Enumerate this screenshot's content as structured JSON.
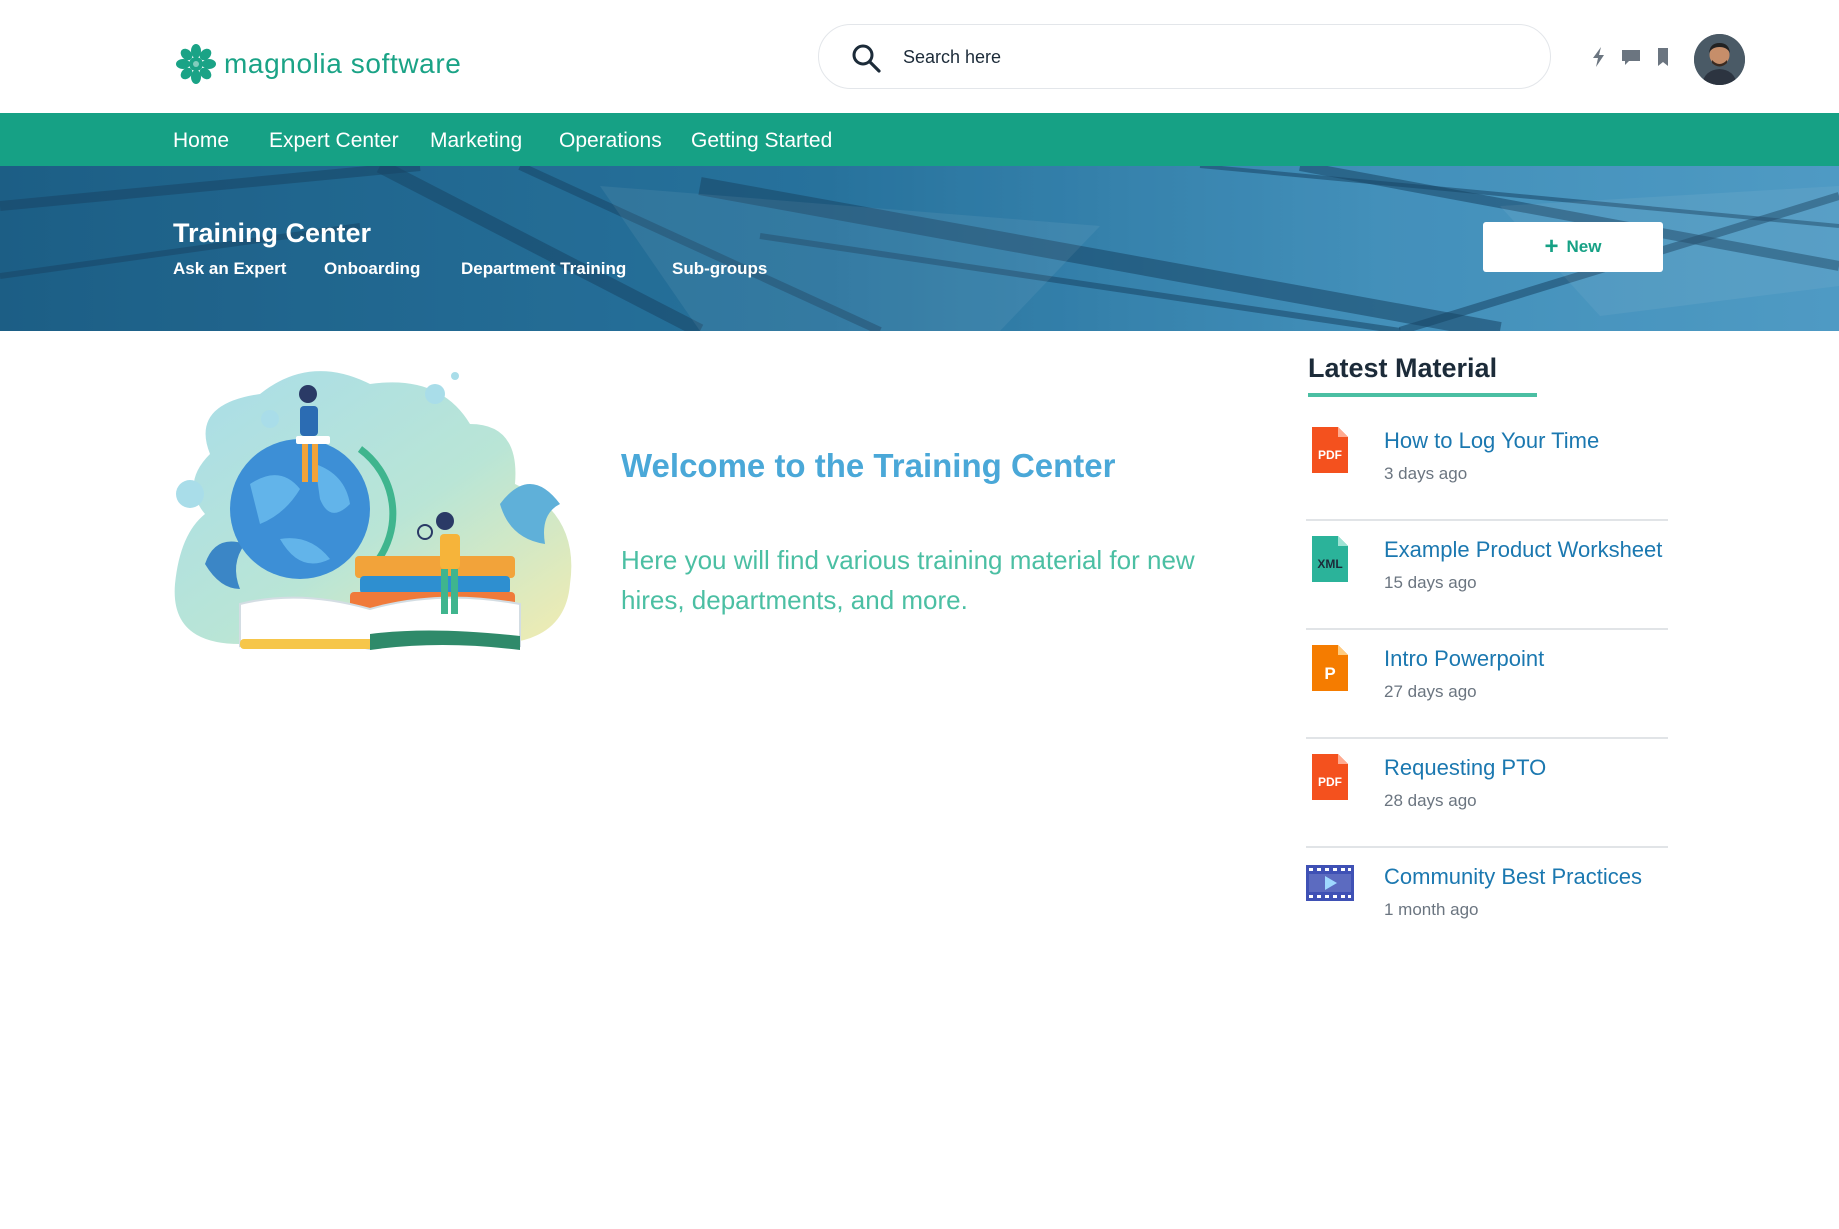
{
  "header": {
    "logo_text": "magnolia software",
    "search_placeholder": "Search here",
    "icons": [
      "lightning-icon",
      "chat-icon",
      "bookmark-icon"
    ]
  },
  "nav": {
    "items": [
      "Home",
      "Expert Center",
      "Marketing",
      "Operations",
      "Getting Started"
    ]
  },
  "banner": {
    "title": "Training Center",
    "subnav": [
      "Ask an Expert",
      "Onboarding",
      "Department Training",
      "Sub-groups"
    ],
    "new_button": "New"
  },
  "main": {
    "welcome_title": "Welcome to the Training Center",
    "welcome_text": "Here you will find various training material for new hires, departments, and more."
  },
  "sidebar": {
    "title": "Latest Material",
    "items": [
      {
        "name": "How to Log Your Time",
        "date": "3 days ago",
        "type": "PDF"
      },
      {
        "name": "Example Product Worksheet",
        "date": "15 days ago",
        "type": "XML"
      },
      {
        "name": "Intro Powerpoint",
        "date": "27 days ago",
        "type": "P"
      },
      {
        "name": "Requesting PTO",
        "date": "28 days ago",
        "type": "PDF"
      },
      {
        "name": "Community Best Practices",
        "date": "1 month ago",
        "type": "video"
      }
    ]
  },
  "colors": {
    "brand": "#16a185",
    "link": "#1b78b0",
    "welcome_title": "#4aa8d8",
    "welcome_text": "#4bbfa3",
    "pdf": "#f4511e",
    "xml": "#2bb39a",
    "ppt": "#f57c00",
    "video": "#3f51b5"
  }
}
